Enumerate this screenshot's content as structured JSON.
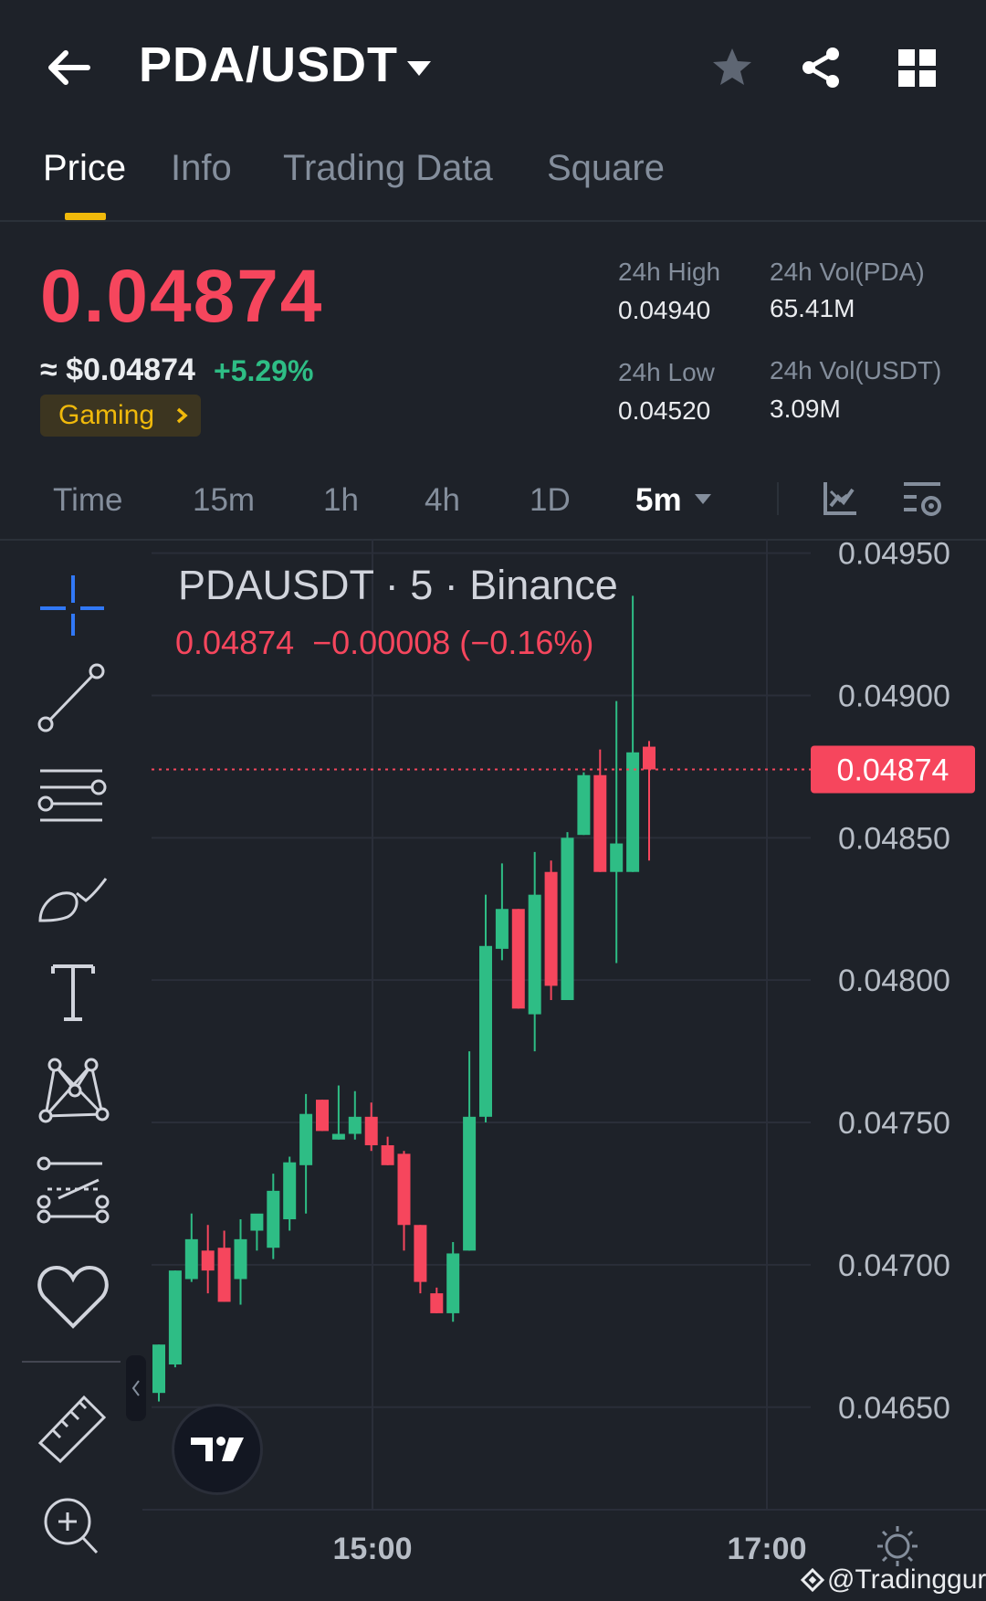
{
  "header": {
    "title": "PDA/USDT"
  },
  "tabs": [
    "Price",
    "Info",
    "Trading Data",
    "Square"
  ],
  "price": {
    "last": "0.04874",
    "approx": "≈ $0.04874",
    "change_pct": "+5.29%",
    "tag": "Gaming",
    "high_label": "24h High",
    "high": "0.04940",
    "low_label": "24h Low",
    "low": "0.04520",
    "vol_base_label": "24h Vol(PDA)",
    "vol_base": "65.41M",
    "vol_quote_label": "24h Vol(USDT)",
    "vol_quote": "3.09M"
  },
  "intervals": [
    "Time",
    "15m",
    "1h",
    "4h",
    "1D"
  ],
  "selected_interval": "5m",
  "chart_legend": {
    "symbol_line": "PDAUSDT · 5 · Binance",
    "value_line": "0.04874  −0.00008 (−0.16%)"
  },
  "watermark": "@Tradingguro",
  "chart_data": {
    "type": "candlestick",
    "title": "PDAUSDT · 5 · Binance",
    "x_ticks": [
      "15:00",
      "17:00"
    ],
    "y_ticks": [
      "0.04950",
      "0.04900",
      "0.04850",
      "0.04800",
      "0.04750",
      "0.04700",
      "0.04650"
    ],
    "ylim": [
      0.04614,
      0.04955
    ],
    "last_price_label": "0.04874",
    "up_color": "#2ebd85",
    "down_color": "#f6465d",
    "candles": [
      {
        "o": 0.04655,
        "h": 0.04672,
        "l": 0.04652,
        "c": 0.04672
      },
      {
        "o": 0.04665,
        "h": 0.04698,
        "l": 0.04664,
        "c": 0.04698
      },
      {
        "o": 0.04695,
        "h": 0.04718,
        "l": 0.04694,
        "c": 0.04709
      },
      {
        "o": 0.04705,
        "h": 0.04714,
        "l": 0.0469,
        "c": 0.04698
      },
      {
        "o": 0.04706,
        "h": 0.04712,
        "l": 0.04687,
        "c": 0.04687
      },
      {
        "o": 0.04695,
        "h": 0.04716,
        "l": 0.04686,
        "c": 0.04709
      },
      {
        "o": 0.04712,
        "h": 0.04717,
        "l": 0.04705,
        "c": 0.04718
      },
      {
        "o": 0.04706,
        "h": 0.04732,
        "l": 0.04702,
        "c": 0.04726
      },
      {
        "o": 0.04716,
        "h": 0.04738,
        "l": 0.04712,
        "c": 0.04736
      },
      {
        "o": 0.04735,
        "h": 0.0476,
        "l": 0.04718,
        "c": 0.04753
      },
      {
        "o": 0.04758,
        "h": 0.04758,
        "l": 0.04747,
        "c": 0.04747
      },
      {
        "o": 0.04744,
        "h": 0.04763,
        "l": 0.04744,
        "c": 0.04746
      },
      {
        "o": 0.04746,
        "h": 0.04761,
        "l": 0.04744,
        "c": 0.04752
      },
      {
        "o": 0.04752,
        "h": 0.04757,
        "l": 0.0474,
        "c": 0.04742
      },
      {
        "o": 0.04742,
        "h": 0.04745,
        "l": 0.04735,
        "c": 0.04735
      },
      {
        "o": 0.04739,
        "h": 0.0474,
        "l": 0.04705,
        "c": 0.04714
      },
      {
        "o": 0.04714,
        "h": 0.04714,
        "l": 0.0469,
        "c": 0.04694
      },
      {
        "o": 0.0469,
        "h": 0.04692,
        "l": 0.04683,
        "c": 0.04683
      },
      {
        "o": 0.04683,
        "h": 0.04708,
        "l": 0.0468,
        "c": 0.04704
      },
      {
        "o": 0.04705,
        "h": 0.04775,
        "l": 0.04705,
        "c": 0.04752
      },
      {
        "o": 0.04752,
        "h": 0.0483,
        "l": 0.0475,
        "c": 0.04812
      },
      {
        "o": 0.04811,
        "h": 0.04841,
        "l": 0.04807,
        "c": 0.04825
      },
      {
        "o": 0.04825,
        "h": 0.04825,
        "l": 0.0479,
        "c": 0.0479
      },
      {
        "o": 0.04788,
        "h": 0.04845,
        "l": 0.04775,
        "c": 0.0483
      },
      {
        "o": 0.04838,
        "h": 0.04842,
        "l": 0.04793,
        "c": 0.04798
      },
      {
        "o": 0.04793,
        "h": 0.04852,
        "l": 0.04793,
        "c": 0.0485
      },
      {
        "o": 0.04851,
        "h": 0.04873,
        "l": 0.04851,
        "c": 0.04872
      },
      {
        "o": 0.04872,
        "h": 0.04881,
        "l": 0.04838,
        "c": 0.04838
      },
      {
        "o": 0.04838,
        "h": 0.04898,
        "l": 0.04806,
        "c": 0.04848
      },
      {
        "o": 0.04838,
        "h": 0.04935,
        "l": 0.04838,
        "c": 0.0488
      },
      {
        "o": 0.04882,
        "h": 0.04884,
        "l": 0.04842,
        "c": 0.04874
      }
    ]
  },
  "colors": {
    "background": "#1e2229",
    "accent": "#f0b90b",
    "up": "#2ebd85",
    "down": "#f6465d"
  },
  "icons": [
    "back-arrow-icon",
    "dropdown-caret-icon",
    "star-icon",
    "share-icon",
    "grid-icon",
    "chevron-right-icon",
    "indicator-icon",
    "chart-settings-icon",
    "crosshair-icon",
    "trend-line-icon",
    "horizontal-lines-icon",
    "brush-icon",
    "text-icon",
    "pattern-icon",
    "fib-icon",
    "heart-icon",
    "ruler-icon",
    "zoom-in-icon",
    "collapse-icon",
    "tradingview-logo-icon",
    "sun-icon",
    "binance-logo-icon"
  ]
}
